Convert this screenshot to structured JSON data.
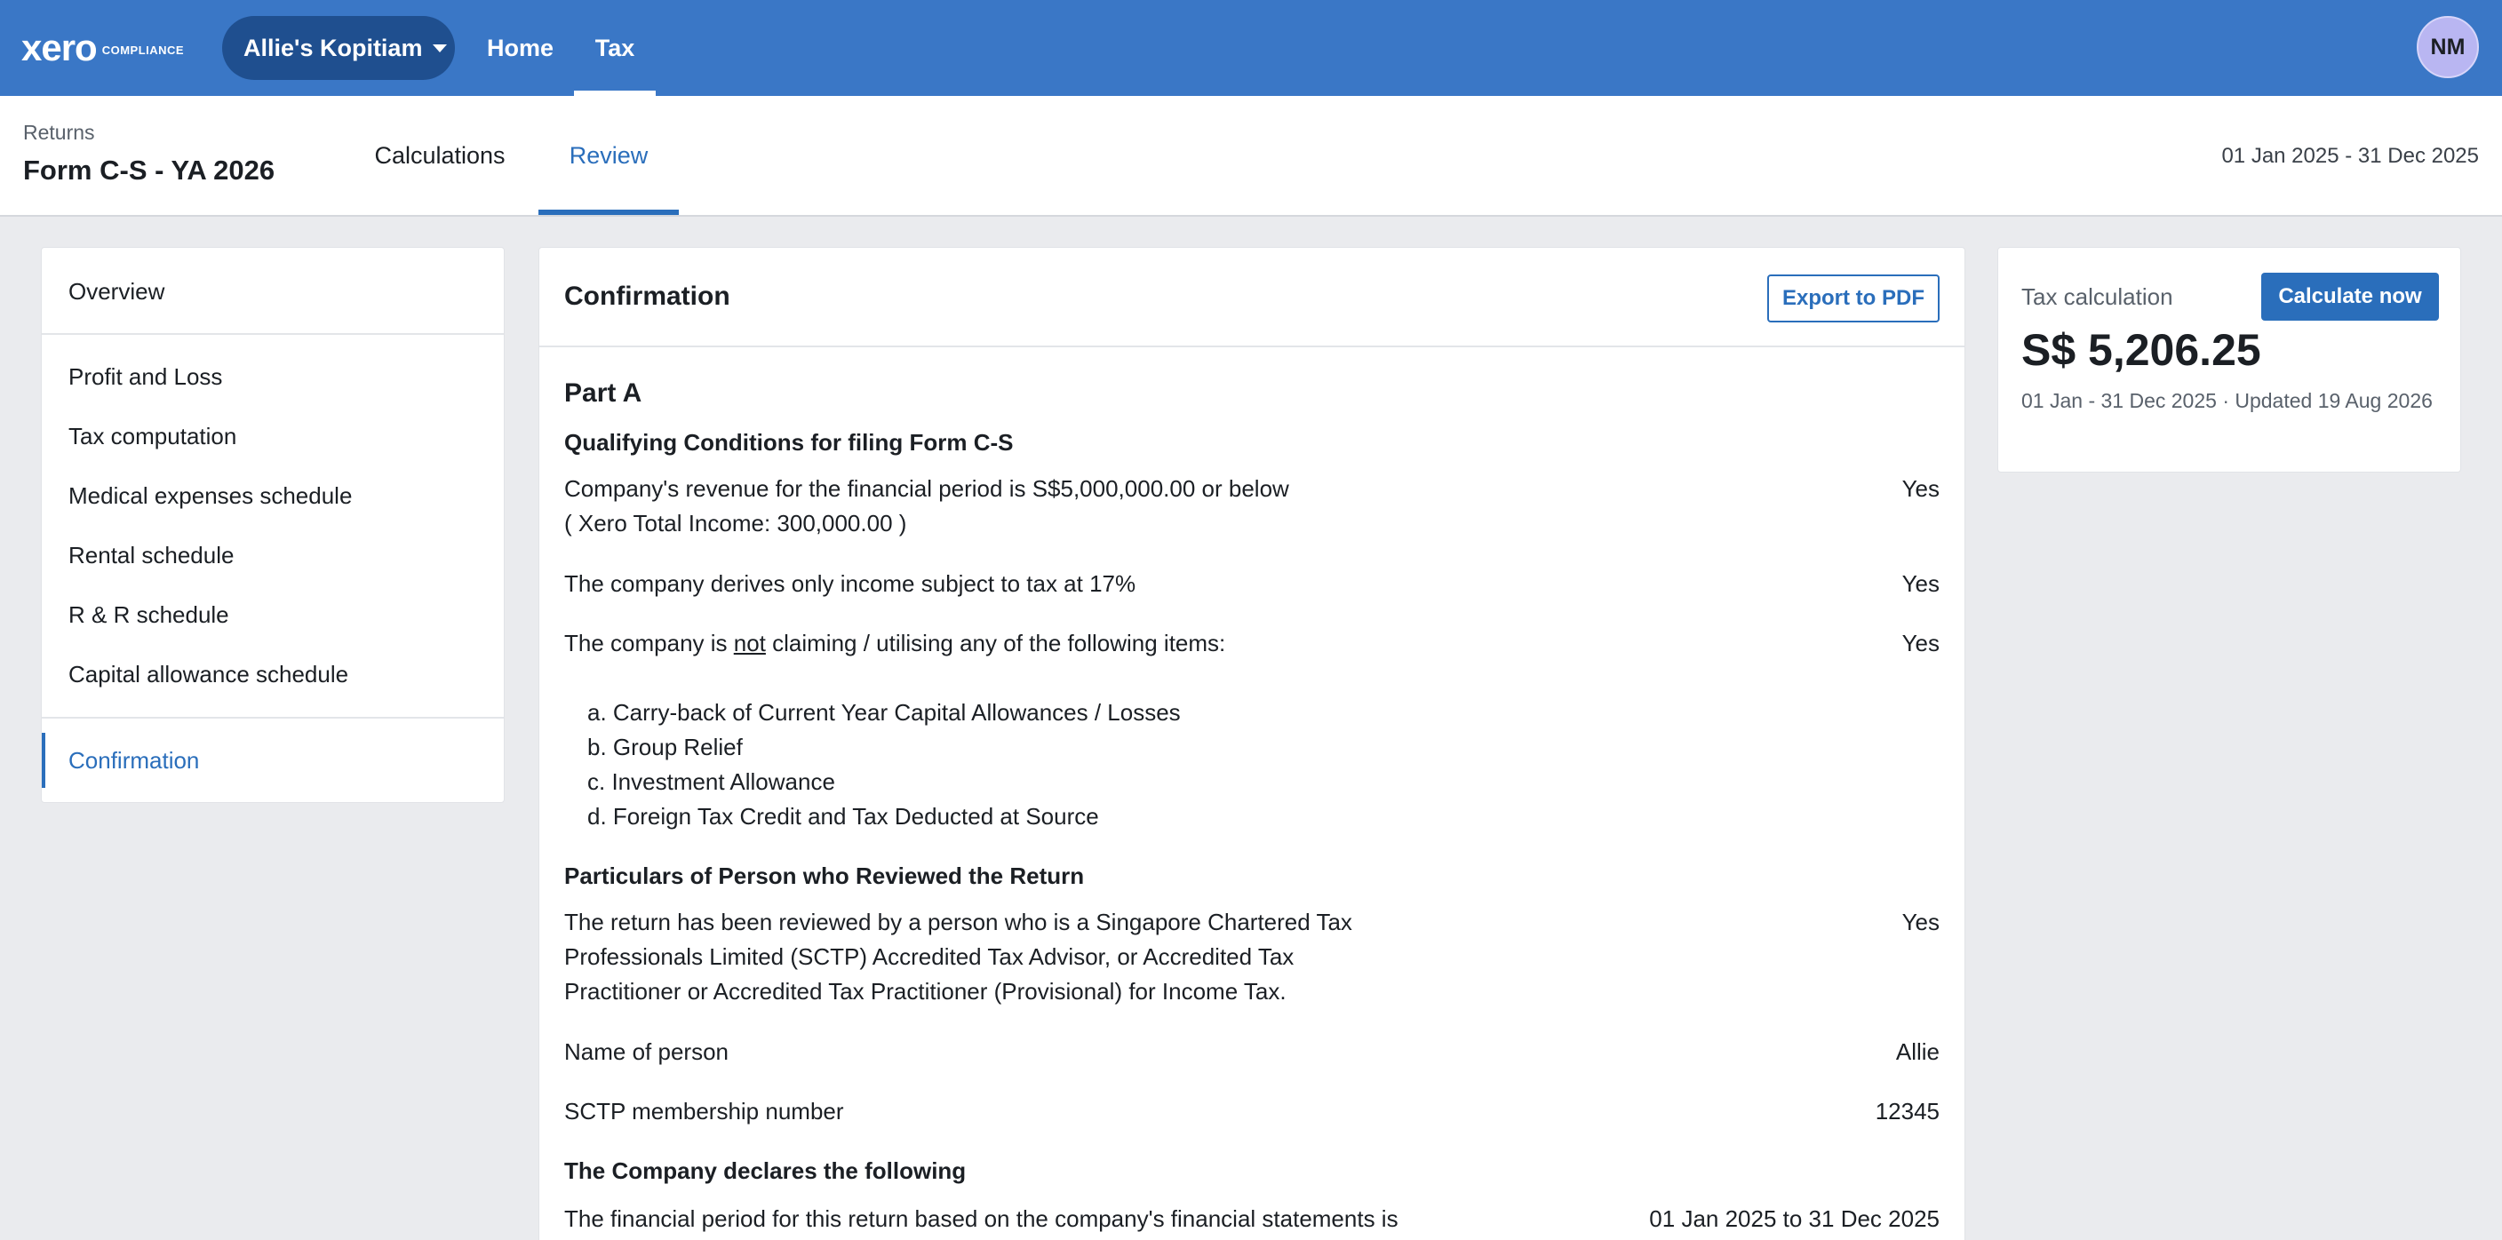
{
  "app": {
    "logo_word": "xero",
    "logo_sub": "COMPLIANCE",
    "org_name": "Allie's Kopitiam",
    "nav": {
      "home": "Home",
      "tax": "Tax"
    },
    "avatar_initials": "NM",
    "colors": {
      "brand": "#3a77c6",
      "accent": "#2a6ebb"
    }
  },
  "subheader": {
    "breadcrumb": "Returns",
    "title": "Form C-S - YA 2026",
    "tabs": {
      "calculations": "Calculations",
      "review": "Review"
    },
    "period": "01 Jan 2025 - 31 Dec 2025"
  },
  "sidebar": {
    "items": [
      "Overview",
      "Profit and Loss",
      "Tax computation",
      "Medical expenses schedule",
      "Rental schedule",
      "R & R schedule",
      "Capital allowance schedule",
      "Confirmation"
    ]
  },
  "main": {
    "title": "Confirmation",
    "export_label": "Export to PDF",
    "part_title": "Part A",
    "qualifying_title": "Qualifying Conditions for filing Form C-S",
    "q1_line1": "Company's revenue for the financial period is S$5,000,000.00 or below",
    "q1_line2": "( Xero Total Income: 300,000.00 )",
    "q1_answer": "Yes",
    "q2": "The company derives only income subject to tax at 17%",
    "q2_answer": "Yes",
    "q3_prefix": "The company is ",
    "q3_emph": "not",
    "q3_suffix": " claiming / utilising any of the following items:",
    "q3_answer": "Yes",
    "q3_items": [
      "a. Carry-back of Current Year Capital Allowances / Losses",
      "b. Group Relief",
      "c. Investment Allowance",
      "d. Foreign Tax Credit and Tax Deducted at Source"
    ],
    "reviewer_title": "Particulars of Person who Reviewed the Return",
    "reviewer_lines": [
      "The return has been reviewed by a person who is a Singapore Chartered Tax",
      "Professionals Limited (SCTP) Accredited Tax Advisor, or Accredited Tax",
      "Practitioner or Accredited Tax Practitioner (Provisional) for Income Tax."
    ],
    "reviewer_answer": "Yes",
    "name_label": "Name of person",
    "name_value": "Allie",
    "sctp_label": "SCTP membership number",
    "sctp_value": "12345",
    "declare_title": "The Company declares the following",
    "period_line": "The financial period for this return based on the company's financial statements is",
    "period_value": "01 Jan 2025 to 31 Dec 2025"
  },
  "tax_card": {
    "label": "Tax calculation",
    "button": "Calculate now",
    "amount": "S$ 5,206.25",
    "meta": "01 Jan - 31 Dec 2025 · Updated 19 Aug 2026"
  }
}
